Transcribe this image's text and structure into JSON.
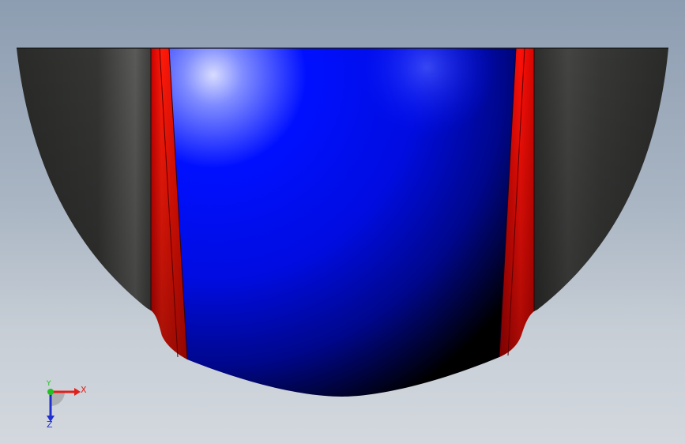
{
  "viewport": {
    "background_top": "#8d9db1",
    "background_bottom": "#d3d8de"
  },
  "model": {
    "body_color": "#0011ff",
    "band_color": "#ff0a00",
    "shell_color": "#2f302e"
  },
  "triad": {
    "x_label": "X",
    "y_label": "Y",
    "z_label": "Z",
    "x_color": "#e0201a",
    "y_color": "#22c022",
    "z_color": "#2030d0"
  }
}
